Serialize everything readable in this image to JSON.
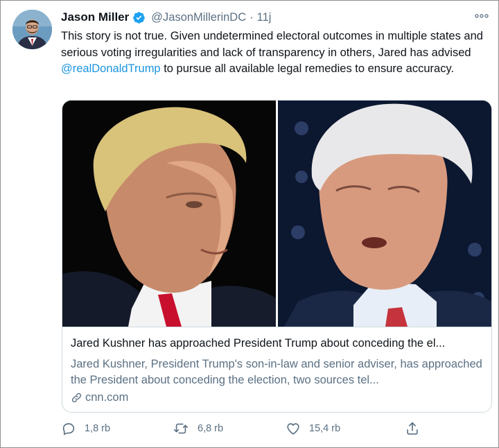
{
  "tweet": {
    "author_name": "Jason Miller",
    "author_handle": "@JasonMillerinDC",
    "separator": "·",
    "timestamp": "11j",
    "text_part1": "This story is not true. Given undetermined electoral outcomes in multiple states and serious voting irregularities and lack of transparency in others, Jared has advised ",
    "mention": "@realDonaldTrump",
    "text_part2": " to pursue all available legal remedies to ensure accuracy."
  },
  "card": {
    "title": "Jared Kushner has approached President Trump about conceding the el...",
    "description": "Jared Kushner, President Trump's son-in-law and senior adviser, has approached the President about conceding the election, two sources tel...",
    "domain": "cnn.com"
  },
  "actions": {
    "reply_count": "1,8 rb",
    "retweet_count": "6,8 rb",
    "like_count": "15,4 rb"
  },
  "colors": {
    "link": "#1b95e0",
    "secondary_text": "#5b7083",
    "verified": "#1da1f2",
    "border": "#cfd9de"
  },
  "icons": [
    "verified-badge-icon",
    "more-options-icon",
    "link-icon",
    "reply-icon",
    "retweet-icon",
    "like-icon",
    "share-icon"
  ]
}
